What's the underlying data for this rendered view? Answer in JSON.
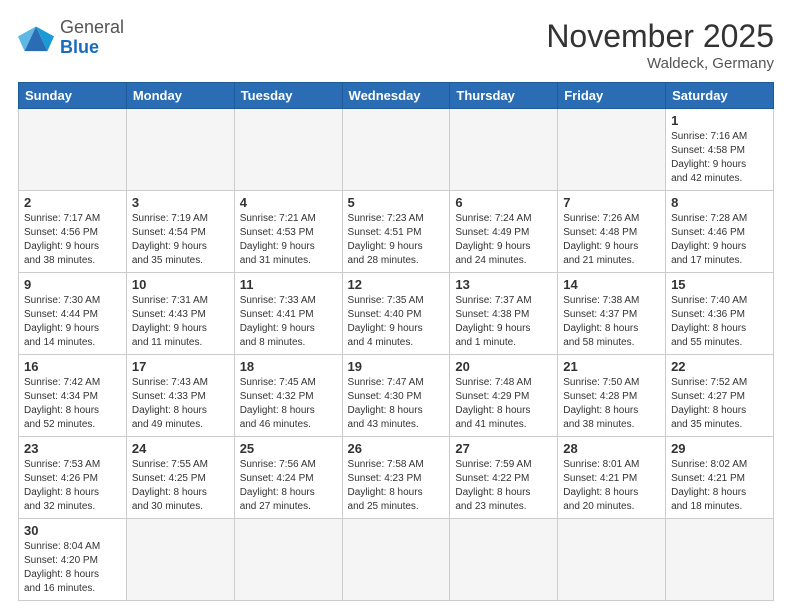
{
  "header": {
    "logo_general": "General",
    "logo_blue": "Blue",
    "month_title": "November 2025",
    "location": "Waldeck, Germany"
  },
  "weekdays": [
    "Sunday",
    "Monday",
    "Tuesday",
    "Wednesday",
    "Thursday",
    "Friday",
    "Saturday"
  ],
  "weeks": [
    [
      {
        "day": "",
        "empty": true,
        "info": ""
      },
      {
        "day": "",
        "empty": true,
        "info": ""
      },
      {
        "day": "",
        "empty": true,
        "info": ""
      },
      {
        "day": "",
        "empty": true,
        "info": ""
      },
      {
        "day": "",
        "empty": true,
        "info": ""
      },
      {
        "day": "",
        "empty": true,
        "info": ""
      },
      {
        "day": "1",
        "empty": false,
        "info": "Sunrise: 7:16 AM\nSunset: 4:58 PM\nDaylight: 9 hours\nand 42 minutes."
      }
    ],
    [
      {
        "day": "2",
        "empty": false,
        "info": "Sunrise: 7:17 AM\nSunset: 4:56 PM\nDaylight: 9 hours\nand 38 minutes."
      },
      {
        "day": "3",
        "empty": false,
        "info": "Sunrise: 7:19 AM\nSunset: 4:54 PM\nDaylight: 9 hours\nand 35 minutes."
      },
      {
        "day": "4",
        "empty": false,
        "info": "Sunrise: 7:21 AM\nSunset: 4:53 PM\nDaylight: 9 hours\nand 31 minutes."
      },
      {
        "day": "5",
        "empty": false,
        "info": "Sunrise: 7:23 AM\nSunset: 4:51 PM\nDaylight: 9 hours\nand 28 minutes."
      },
      {
        "day": "6",
        "empty": false,
        "info": "Sunrise: 7:24 AM\nSunset: 4:49 PM\nDaylight: 9 hours\nand 24 minutes."
      },
      {
        "day": "7",
        "empty": false,
        "info": "Sunrise: 7:26 AM\nSunset: 4:48 PM\nDaylight: 9 hours\nand 21 minutes."
      },
      {
        "day": "8",
        "empty": false,
        "info": "Sunrise: 7:28 AM\nSunset: 4:46 PM\nDaylight: 9 hours\nand 17 minutes."
      }
    ],
    [
      {
        "day": "9",
        "empty": false,
        "info": "Sunrise: 7:30 AM\nSunset: 4:44 PM\nDaylight: 9 hours\nand 14 minutes."
      },
      {
        "day": "10",
        "empty": false,
        "info": "Sunrise: 7:31 AM\nSunset: 4:43 PM\nDaylight: 9 hours\nand 11 minutes."
      },
      {
        "day": "11",
        "empty": false,
        "info": "Sunrise: 7:33 AM\nSunset: 4:41 PM\nDaylight: 9 hours\nand 8 minutes."
      },
      {
        "day": "12",
        "empty": false,
        "info": "Sunrise: 7:35 AM\nSunset: 4:40 PM\nDaylight: 9 hours\nand 4 minutes."
      },
      {
        "day": "13",
        "empty": false,
        "info": "Sunrise: 7:37 AM\nSunset: 4:38 PM\nDaylight: 9 hours\nand 1 minute."
      },
      {
        "day": "14",
        "empty": false,
        "info": "Sunrise: 7:38 AM\nSunset: 4:37 PM\nDaylight: 8 hours\nand 58 minutes."
      },
      {
        "day": "15",
        "empty": false,
        "info": "Sunrise: 7:40 AM\nSunset: 4:36 PM\nDaylight: 8 hours\nand 55 minutes."
      }
    ],
    [
      {
        "day": "16",
        "empty": false,
        "info": "Sunrise: 7:42 AM\nSunset: 4:34 PM\nDaylight: 8 hours\nand 52 minutes."
      },
      {
        "day": "17",
        "empty": false,
        "info": "Sunrise: 7:43 AM\nSunset: 4:33 PM\nDaylight: 8 hours\nand 49 minutes."
      },
      {
        "day": "18",
        "empty": false,
        "info": "Sunrise: 7:45 AM\nSunset: 4:32 PM\nDaylight: 8 hours\nand 46 minutes."
      },
      {
        "day": "19",
        "empty": false,
        "info": "Sunrise: 7:47 AM\nSunset: 4:30 PM\nDaylight: 8 hours\nand 43 minutes."
      },
      {
        "day": "20",
        "empty": false,
        "info": "Sunrise: 7:48 AM\nSunset: 4:29 PM\nDaylight: 8 hours\nand 41 minutes."
      },
      {
        "day": "21",
        "empty": false,
        "info": "Sunrise: 7:50 AM\nSunset: 4:28 PM\nDaylight: 8 hours\nand 38 minutes."
      },
      {
        "day": "22",
        "empty": false,
        "info": "Sunrise: 7:52 AM\nSunset: 4:27 PM\nDaylight: 8 hours\nand 35 minutes."
      }
    ],
    [
      {
        "day": "23",
        "empty": false,
        "info": "Sunrise: 7:53 AM\nSunset: 4:26 PM\nDaylight: 8 hours\nand 32 minutes."
      },
      {
        "day": "24",
        "empty": false,
        "info": "Sunrise: 7:55 AM\nSunset: 4:25 PM\nDaylight: 8 hours\nand 30 minutes."
      },
      {
        "day": "25",
        "empty": false,
        "info": "Sunrise: 7:56 AM\nSunset: 4:24 PM\nDaylight: 8 hours\nand 27 minutes."
      },
      {
        "day": "26",
        "empty": false,
        "info": "Sunrise: 7:58 AM\nSunset: 4:23 PM\nDaylight: 8 hours\nand 25 minutes."
      },
      {
        "day": "27",
        "empty": false,
        "info": "Sunrise: 7:59 AM\nSunset: 4:22 PM\nDaylight: 8 hours\nand 23 minutes."
      },
      {
        "day": "28",
        "empty": false,
        "info": "Sunrise: 8:01 AM\nSunset: 4:21 PM\nDaylight: 8 hours\nand 20 minutes."
      },
      {
        "day": "29",
        "empty": false,
        "info": "Sunrise: 8:02 AM\nSunset: 4:21 PM\nDaylight: 8 hours\nand 18 minutes."
      }
    ],
    [
      {
        "day": "30",
        "empty": false,
        "info": "Sunrise: 8:04 AM\nSunset: 4:20 PM\nDaylight: 8 hours\nand 16 minutes."
      },
      {
        "day": "",
        "empty": true,
        "info": ""
      },
      {
        "day": "",
        "empty": true,
        "info": ""
      },
      {
        "day": "",
        "empty": true,
        "info": ""
      },
      {
        "day": "",
        "empty": true,
        "info": ""
      },
      {
        "day": "",
        "empty": true,
        "info": ""
      },
      {
        "day": "",
        "empty": true,
        "info": ""
      }
    ]
  ]
}
